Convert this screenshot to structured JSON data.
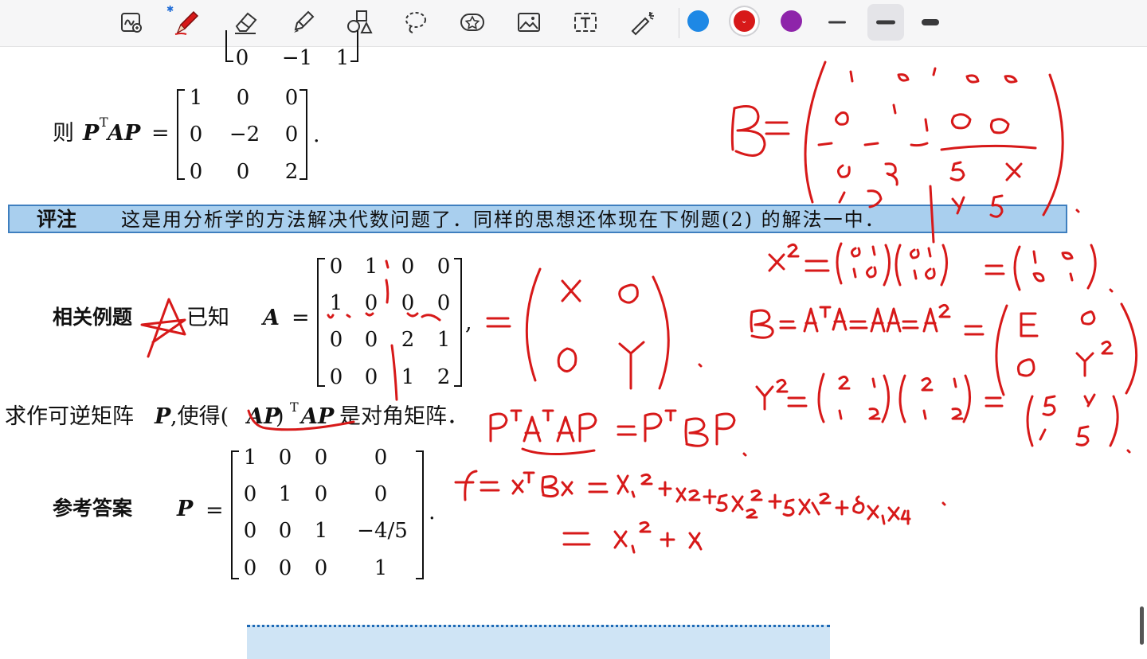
{
  "toolbar": {
    "tools": [
      "zoom-lasso-icon",
      "pen-icon",
      "eraser-icon",
      "highlighter-icon",
      "shapes-icon",
      "lasso-icon",
      "sticker-icon",
      "image-icon",
      "text-icon",
      "laser-pointer-icon"
    ],
    "bluetooth_glyph": "✱",
    "colors": {
      "blue": "#1e88e5",
      "red": "#d71919",
      "purple": "#8e24aa"
    }
  },
  "doc": {
    "top_matrix_row": [
      "0",
      "−1",
      "1"
    ],
    "then_label": "则",
    "ptap": "P",
    "ptap_sup": "T",
    "ptap_rest": "AP",
    "eq": "=",
    "result_matrix": [
      [
        "1",
        "0",
        "0"
      ],
      [
        "0",
        "−2",
        "0"
      ],
      [
        "0",
        "0",
        "2"
      ]
    ],
    "period": ".",
    "note_label": "评注",
    "note_text": "这是用分析学的方法解决代数问题了．同样的思想还体现在下例题(2) 的解法一中．",
    "related_label": "相关例题",
    "known": "已知",
    "a_symbol": "A",
    "a_matrix": [
      [
        "0",
        "1",
        "0",
        "0"
      ],
      [
        "1",
        "0",
        "0",
        "0"
      ],
      [
        "0",
        "0",
        "2",
        "1"
      ],
      [
        "0",
        "0",
        "1",
        "2"
      ]
    ],
    "comma": ",",
    "question_text_1": "求作可逆矩阵",
    "question_p": "P",
    "question_text_2": ",使得(",
    "question_ap": "AP",
    "question_close": ")",
    "question_sup": "T",
    "question_ap2": "AP",
    "question_text_3": "是对角矩阵．",
    "answer_label": "参考答案",
    "p_symbol": "P",
    "p_matrix": [
      [
        "1",
        "0",
        "0",
        "0"
      ],
      [
        "0",
        "1",
        "0",
        "0"
      ],
      [
        "0",
        "0",
        "1",
        "−4/5"
      ],
      [
        "0",
        "0",
        "0",
        "1"
      ]
    ]
  }
}
